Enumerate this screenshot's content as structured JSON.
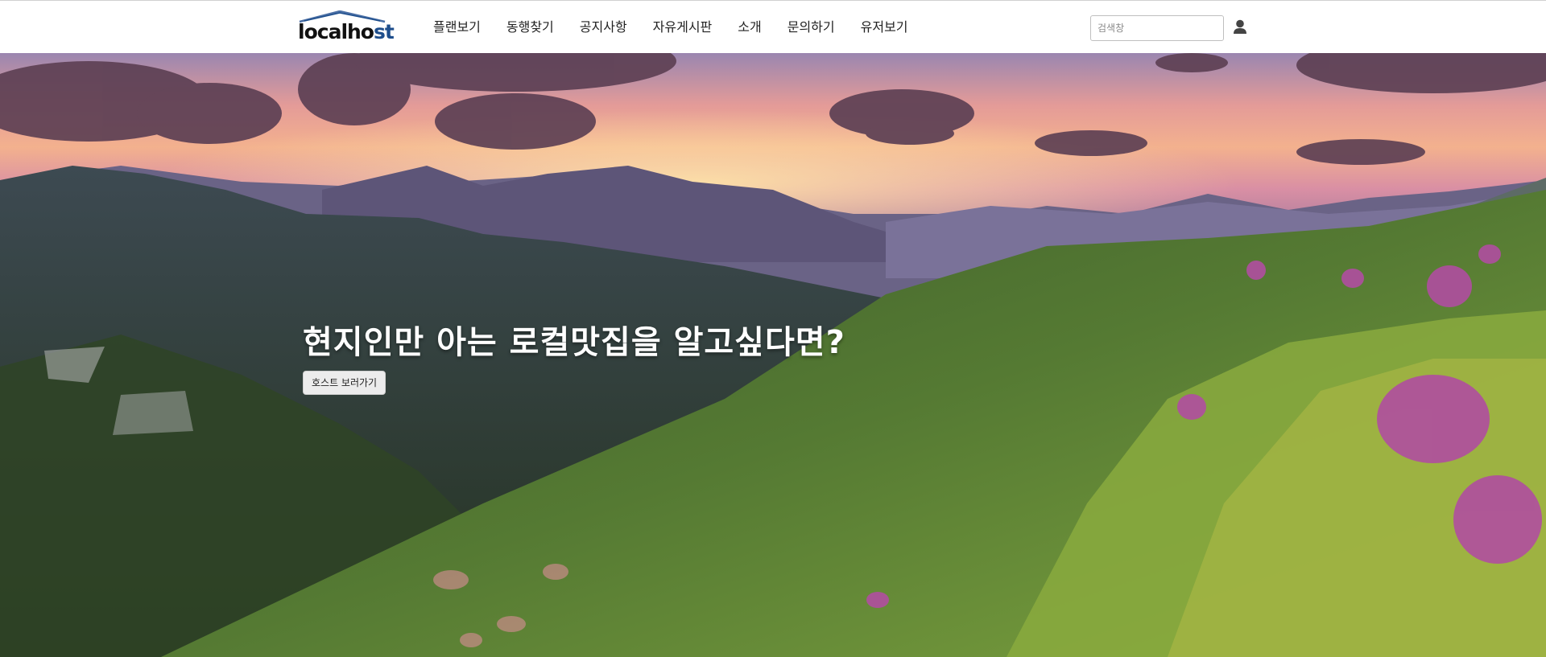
{
  "brand": {
    "logo_text_part1": "lo",
    "logo_text_part2": "calho",
    "logo_text_part3": "st",
    "logo_icon": "house-roof-icon",
    "logo_accent_color": "#1e4e8c"
  },
  "nav": {
    "items": [
      {
        "label": "플랜보기"
      },
      {
        "label": "동행찾기"
      },
      {
        "label": "공지사항"
      },
      {
        "label": "자유게시판"
      },
      {
        "label": "소개"
      },
      {
        "label": "문의하기"
      },
      {
        "label": "유저보기"
      }
    ]
  },
  "search": {
    "placeholder": "검색창",
    "value": ""
  },
  "user": {
    "icon": "user-icon"
  },
  "hero": {
    "background": "sunset-mountain-meadow-photo",
    "headline": "현지인만 아는 로컬맛집을 알고싶다면?",
    "button_label": "호스트 보러가기"
  }
}
